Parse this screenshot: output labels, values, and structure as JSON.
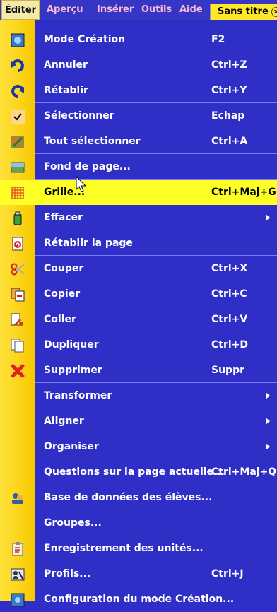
{
  "menubar": {
    "items": [
      "Éditer",
      "Aperçu",
      "Insérer",
      "Outils",
      "Aide"
    ],
    "document_title": "Sans titre"
  },
  "menu": {
    "items": [
      {
        "label": "Mode Création",
        "shortcut": "F2",
        "icon": "mode-creation-icon"
      },
      {
        "label": "Annuler",
        "shortcut": "Ctrl+Z",
        "icon": "undo-icon"
      },
      {
        "label": "Rétablir",
        "shortcut": "Ctrl+Y",
        "icon": "redo-icon"
      },
      {
        "label": "Sélectionner",
        "shortcut": "Echap",
        "icon": "check-icon"
      },
      {
        "label": "Tout sélectionner",
        "shortcut": "Ctrl+A",
        "icon": "select-all-icon"
      },
      {
        "label": "Fond de page...",
        "shortcut": "",
        "icon": "background-icon"
      },
      {
        "label": "Grille...",
        "shortcut": "Ctrl+Maj+G",
        "icon": "grid-icon",
        "highlighted": true
      },
      {
        "label": "Effacer",
        "shortcut": "",
        "icon": "eraser-icon",
        "submenu": true
      },
      {
        "label": "Rétablir la page",
        "shortcut": "",
        "icon": "reset-page-icon"
      },
      {
        "label": "Couper",
        "shortcut": "Ctrl+X",
        "icon": "cut-icon"
      },
      {
        "label": "Copier",
        "shortcut": "Ctrl+C",
        "icon": "copy-icon"
      },
      {
        "label": "Coller",
        "shortcut": "Ctrl+V",
        "icon": "paste-icon"
      },
      {
        "label": "Dupliquer",
        "shortcut": "Ctrl+D",
        "icon": "duplicate-icon"
      },
      {
        "label": "Supprimer",
        "shortcut": "Suppr",
        "icon": "delete-icon"
      },
      {
        "label": "Transformer",
        "shortcut": "",
        "icon": "",
        "submenu": true
      },
      {
        "label": "Aligner",
        "shortcut": "",
        "icon": "",
        "submenu": true
      },
      {
        "label": "Organiser",
        "shortcut": "",
        "icon": "",
        "submenu": true
      },
      {
        "label": "Questions sur la page actuelle...",
        "shortcut": "Ctrl+Maj+Q",
        "icon": ""
      },
      {
        "label": "Base de données des élèves...",
        "shortcut": "",
        "icon": "students-database-icon"
      },
      {
        "label": "Groupes...",
        "shortcut": "",
        "icon": ""
      },
      {
        "label": "Enregistrement des unités...",
        "shortcut": "",
        "icon": "clipboard-icon"
      },
      {
        "label": "Profils...",
        "shortcut": "Ctrl+J",
        "icon": "profiles-icon"
      },
      {
        "label": "Configuration du mode Création...",
        "shortcut": "",
        "icon": "config-icon"
      }
    ]
  }
}
